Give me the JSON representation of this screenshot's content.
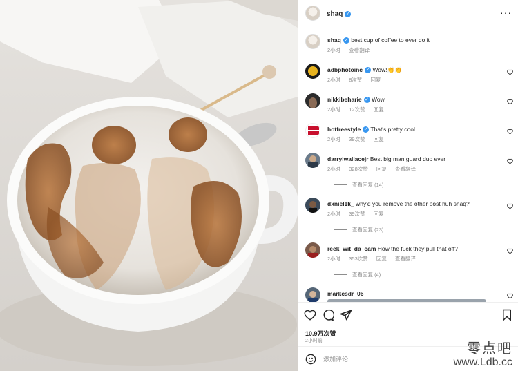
{
  "post": {
    "username": "shaq",
    "verified": true,
    "more_icon": "more-horizontal-icon"
  },
  "caption": {
    "username": "shaq",
    "text": "best cup of coffee to ever do it",
    "time": "2小时",
    "translate": "查看翻译"
  },
  "comments": [
    {
      "username": "adbphotoinc",
      "verified": true,
      "text": "Wow!👏👏",
      "time": "2小时",
      "likes": "8次赞",
      "reply": "回复",
      "translate": "",
      "avatar_color": "#1a1a1a"
    },
    {
      "username": "nikkibeharie",
      "verified": true,
      "text": "Wow",
      "time": "2小时",
      "likes": "12次赞",
      "reply": "回复",
      "translate": "",
      "avatar_color": "#2b2b2b"
    },
    {
      "username": "hotfreestyle",
      "verified": true,
      "text": "That's pretty cool",
      "time": "2小时",
      "likes": "39次赞",
      "reply": "回复",
      "translate": "",
      "avatar_color": "#c8102e"
    },
    {
      "username": "darrylwallacejr",
      "verified": false,
      "text": "Best big man guard duo ever",
      "time": "2小时",
      "likes": "328次赞",
      "reply": "回复",
      "translate": "查看翻译",
      "view_replies": "查看回复 (14)",
      "avatar_color": "#6a7a8a"
    },
    {
      "username": "dxniel1k_",
      "verified": false,
      "text": "why'd you remove the other post huh shaq?",
      "time": "2小时",
      "likes": "39次赞",
      "reply": "回复",
      "translate": "",
      "view_replies": "查看回复 (23)",
      "avatar_color": "#3a4a5a"
    },
    {
      "username": "reek_wit_da_cam",
      "verified": false,
      "text": "How the fuck they pull that off?",
      "time": "2小时",
      "likes": "353次赞",
      "reply": "回复",
      "translate": "查看翻译",
      "view_replies": "查看回复 (4)",
      "avatar_color": "#7a5a4a"
    },
    {
      "username": "markcsdr_06",
      "verified": false,
      "text": "",
      "time": "",
      "likes": "",
      "reply": "",
      "translate": "",
      "avatar_color": "#556677"
    }
  ],
  "actions": {
    "like_icon": "heart-icon",
    "comment_icon": "comment-icon",
    "share_icon": "share-icon",
    "save_icon": "bookmark-icon"
  },
  "likes_count": "10.9万次赞",
  "post_time": "2小时前",
  "add_comment": {
    "placeholder": "添加评论...",
    "emoji_icon": "emoji-icon"
  },
  "watermark": {
    "cn": "零点吧",
    "url": "www.Ldb.cc"
  }
}
